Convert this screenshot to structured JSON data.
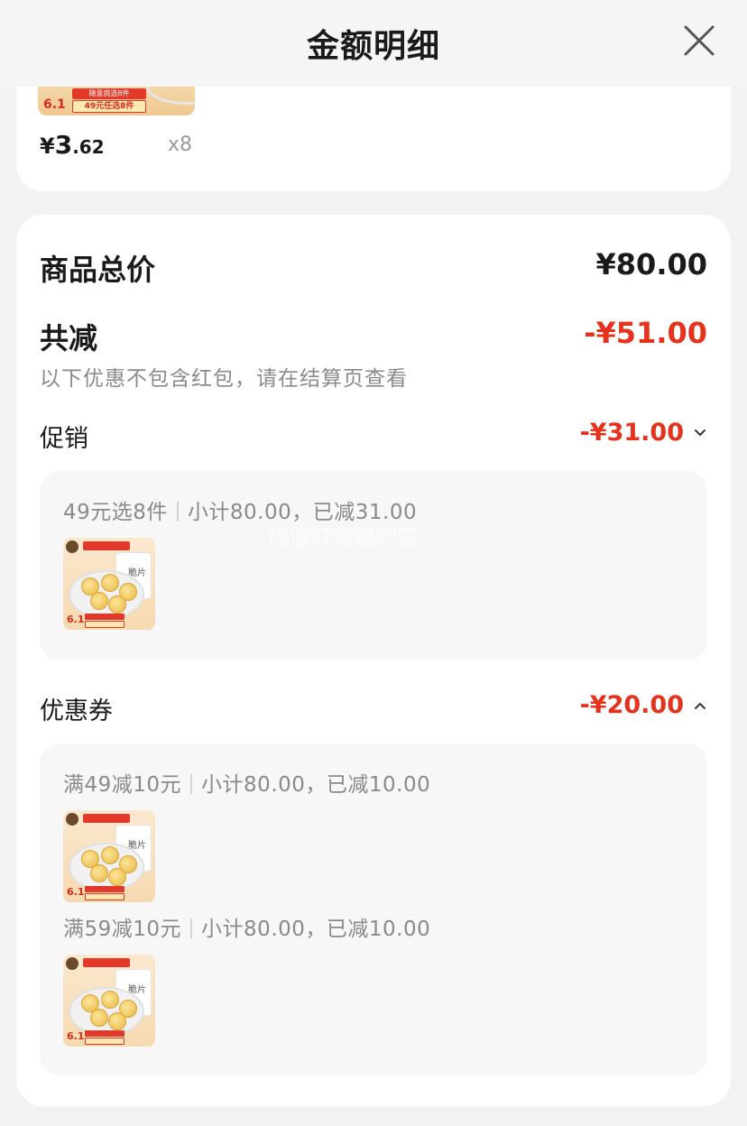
{
  "header": {
    "title": "金额明细",
    "close_icon": "close-icon"
  },
  "top_item": {
    "price_currency": "¥",
    "price_int": "3",
    "price_dec": ".62",
    "qty": "x8",
    "thumb_badge_number": "6.1",
    "thumb_badge_top": "随意挑选8件",
    "thumb_badge_bottom": "49元任选8件"
  },
  "summary": {
    "total_label": "商品总价",
    "total_value": "¥80.00",
    "minus_label": "共减",
    "minus_value": "-¥51.00",
    "note": "以下优惠不包含红包，请在结算页查看"
  },
  "promotion": {
    "label": "促销",
    "value": "-¥31.00",
    "chevron_icon": "chevron-down-icon",
    "lines": [
      {
        "rule": "49元选8件",
        "detail": "小计80.00，已减31.00"
      }
    ],
    "watermark": "优选好物福利官"
  },
  "coupon": {
    "label": "优惠券",
    "value": "-¥20.00",
    "chevron_icon": "chevron-up-icon",
    "lines": [
      {
        "rule": "满49减10元",
        "detail": "小计80.00，已减10.00"
      },
      {
        "rule": "满59减10元",
        "detail": "小计80.00，已减10.00"
      }
    ]
  },
  "product_thumb": {
    "bag_text": "脆片",
    "badge_number": "6.1"
  },
  "colors": {
    "accent_red": "#e5321d",
    "text_primary": "#1a1a1a",
    "text_secondary": "#8a8a8a",
    "panel_bg": "#f7f7f7",
    "page_bg": "#f2f2f2"
  }
}
